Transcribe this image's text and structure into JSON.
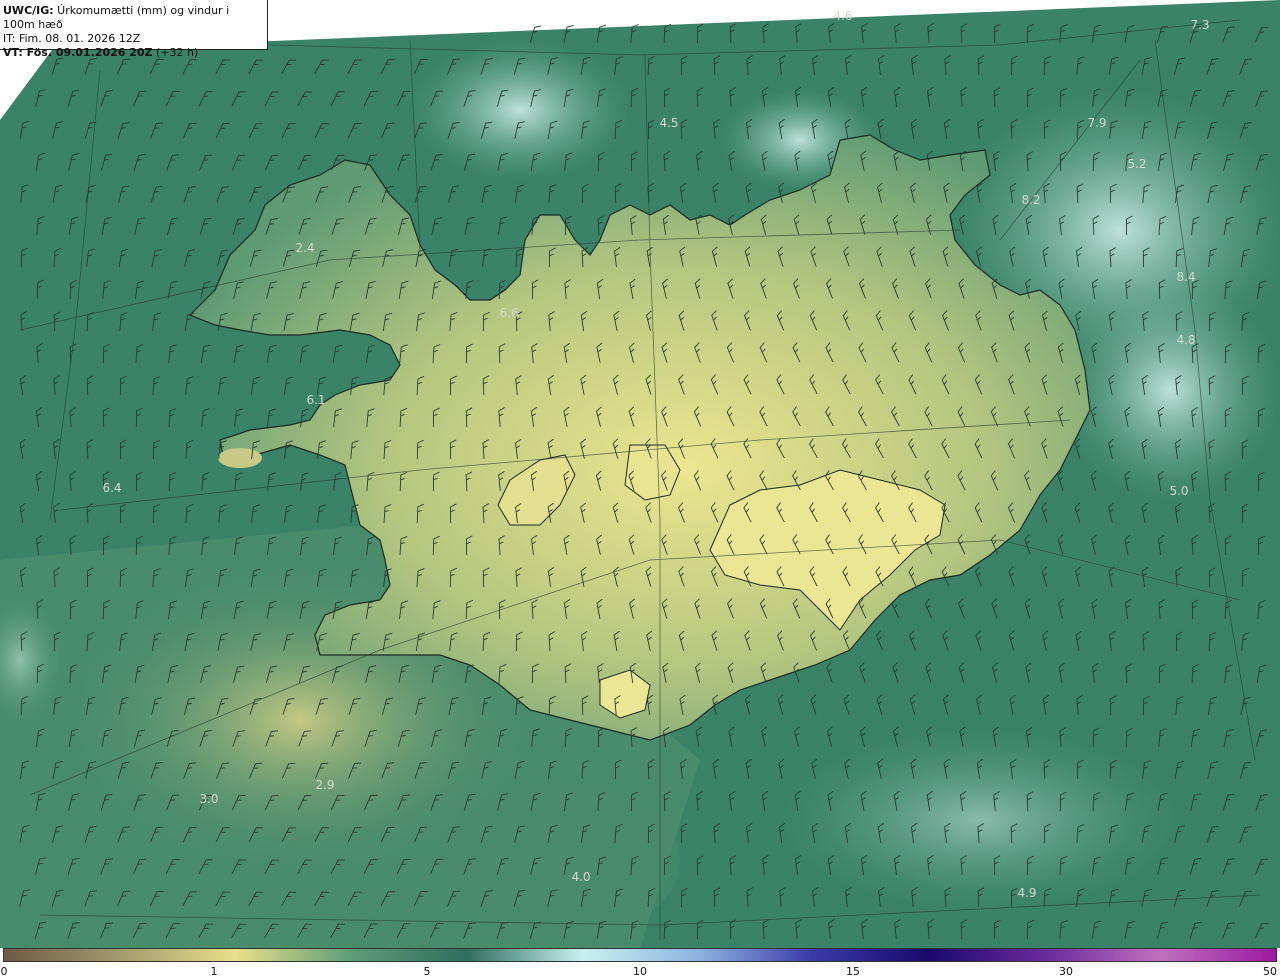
{
  "header": {
    "line1_bold": "UWC/IG:",
    "line1_rest": " Úrkomumætti (mm) og vindur i 100m hæð",
    "line2": "IT: Fim. 08. 01. 2026 12Z",
    "line3_bold": "VT: Fös. 09.01.2026 20Z",
    "line3_rest": " (+32 h)"
  },
  "map_values": [
    "4.6",
    "7.3",
    "4.5",
    "7.9",
    "5.2",
    "8.2",
    "8.4",
    "2.4",
    "6.6",
    "4.8",
    "6.1",
    "6.4",
    "5.0",
    "2.9",
    "3.0",
    "4.0",
    "4.9"
  ],
  "colorbar": {
    "labels": [
      "0",
      "1",
      "5",
      "10",
      "15",
      "30",
      "50"
    ],
    "colors": [
      "#6e5a46",
      "#a39a6e",
      "#e8e08a",
      "#5e9c78",
      "#2f6f5d",
      "#c8f0ee",
      "#8fb4e0",
      "#3a3aa8",
      "#1a0a6a",
      "#6a2a9a",
      "#c070c0",
      "#9a1aa0"
    ]
  },
  "palette": {
    "sea_dark": "#2f6f5d",
    "sea_mid": "#3f8c70",
    "land_low": "#6aa07a",
    "land_high": "#e6e28e",
    "cloud": "#cfeee6"
  }
}
